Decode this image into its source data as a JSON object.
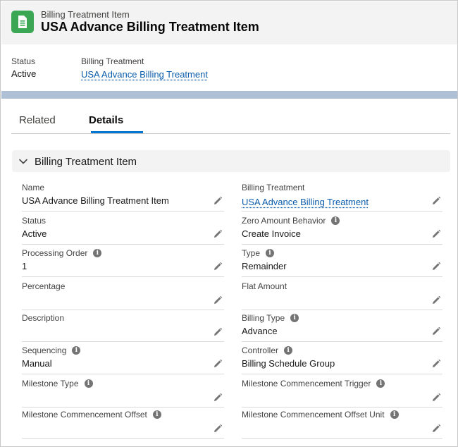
{
  "header": {
    "object_type": "Billing Treatment Item",
    "title": "USA Advance Billing Treatment Item",
    "icon": "document-icon",
    "icon_color": "#3ba755"
  },
  "highlights": {
    "status_label": "Status",
    "status_value": "Active",
    "billing_treatment_label": "Billing Treatment",
    "billing_treatment_value": "USA Advance Billing Treatment"
  },
  "tabs": [
    {
      "label": "Related",
      "active": false
    },
    {
      "label": "Details",
      "active": true
    }
  ],
  "section": {
    "title": "Billing Treatment Item",
    "expanded": true
  },
  "fields_left": [
    {
      "label": "Name",
      "value": "USA Advance Billing Treatment Item",
      "info": false
    },
    {
      "label": "Status",
      "value": "Active",
      "info": false
    },
    {
      "label": "Processing Order",
      "value": "1",
      "info": true
    },
    {
      "label": "Percentage",
      "value": "",
      "info": false
    },
    {
      "label": "Description",
      "value": "",
      "info": false
    },
    {
      "label": "Sequencing",
      "value": "Manual",
      "info": true
    },
    {
      "label": "Milestone Type",
      "value": "",
      "info": true
    },
    {
      "label": "Milestone Commencement Offset",
      "value": "",
      "info": true
    }
  ],
  "fields_right": [
    {
      "label": "Billing Treatment",
      "value": "USA Advance Billing Treatment",
      "info": false,
      "link": true
    },
    {
      "label": "Zero Amount Behavior",
      "value": "Create Invoice",
      "info": true
    },
    {
      "label": "Type",
      "value": "Remainder",
      "info": true
    },
    {
      "label": "Flat Amount",
      "value": "",
      "info": false
    },
    {
      "label": "Billing Type",
      "value": "Advance",
      "info": true
    },
    {
      "label": "Controller",
      "value": "Billing Schedule Group",
      "info": true
    },
    {
      "label": "Milestone Commencement Trigger",
      "value": "",
      "info": true
    },
    {
      "label": "Milestone Commencement Offset Unit",
      "value": "",
      "info": true
    }
  ],
  "colors": {
    "link": "#0b5cab",
    "tab_active": "#0176d3",
    "band": "#aebfd6"
  }
}
